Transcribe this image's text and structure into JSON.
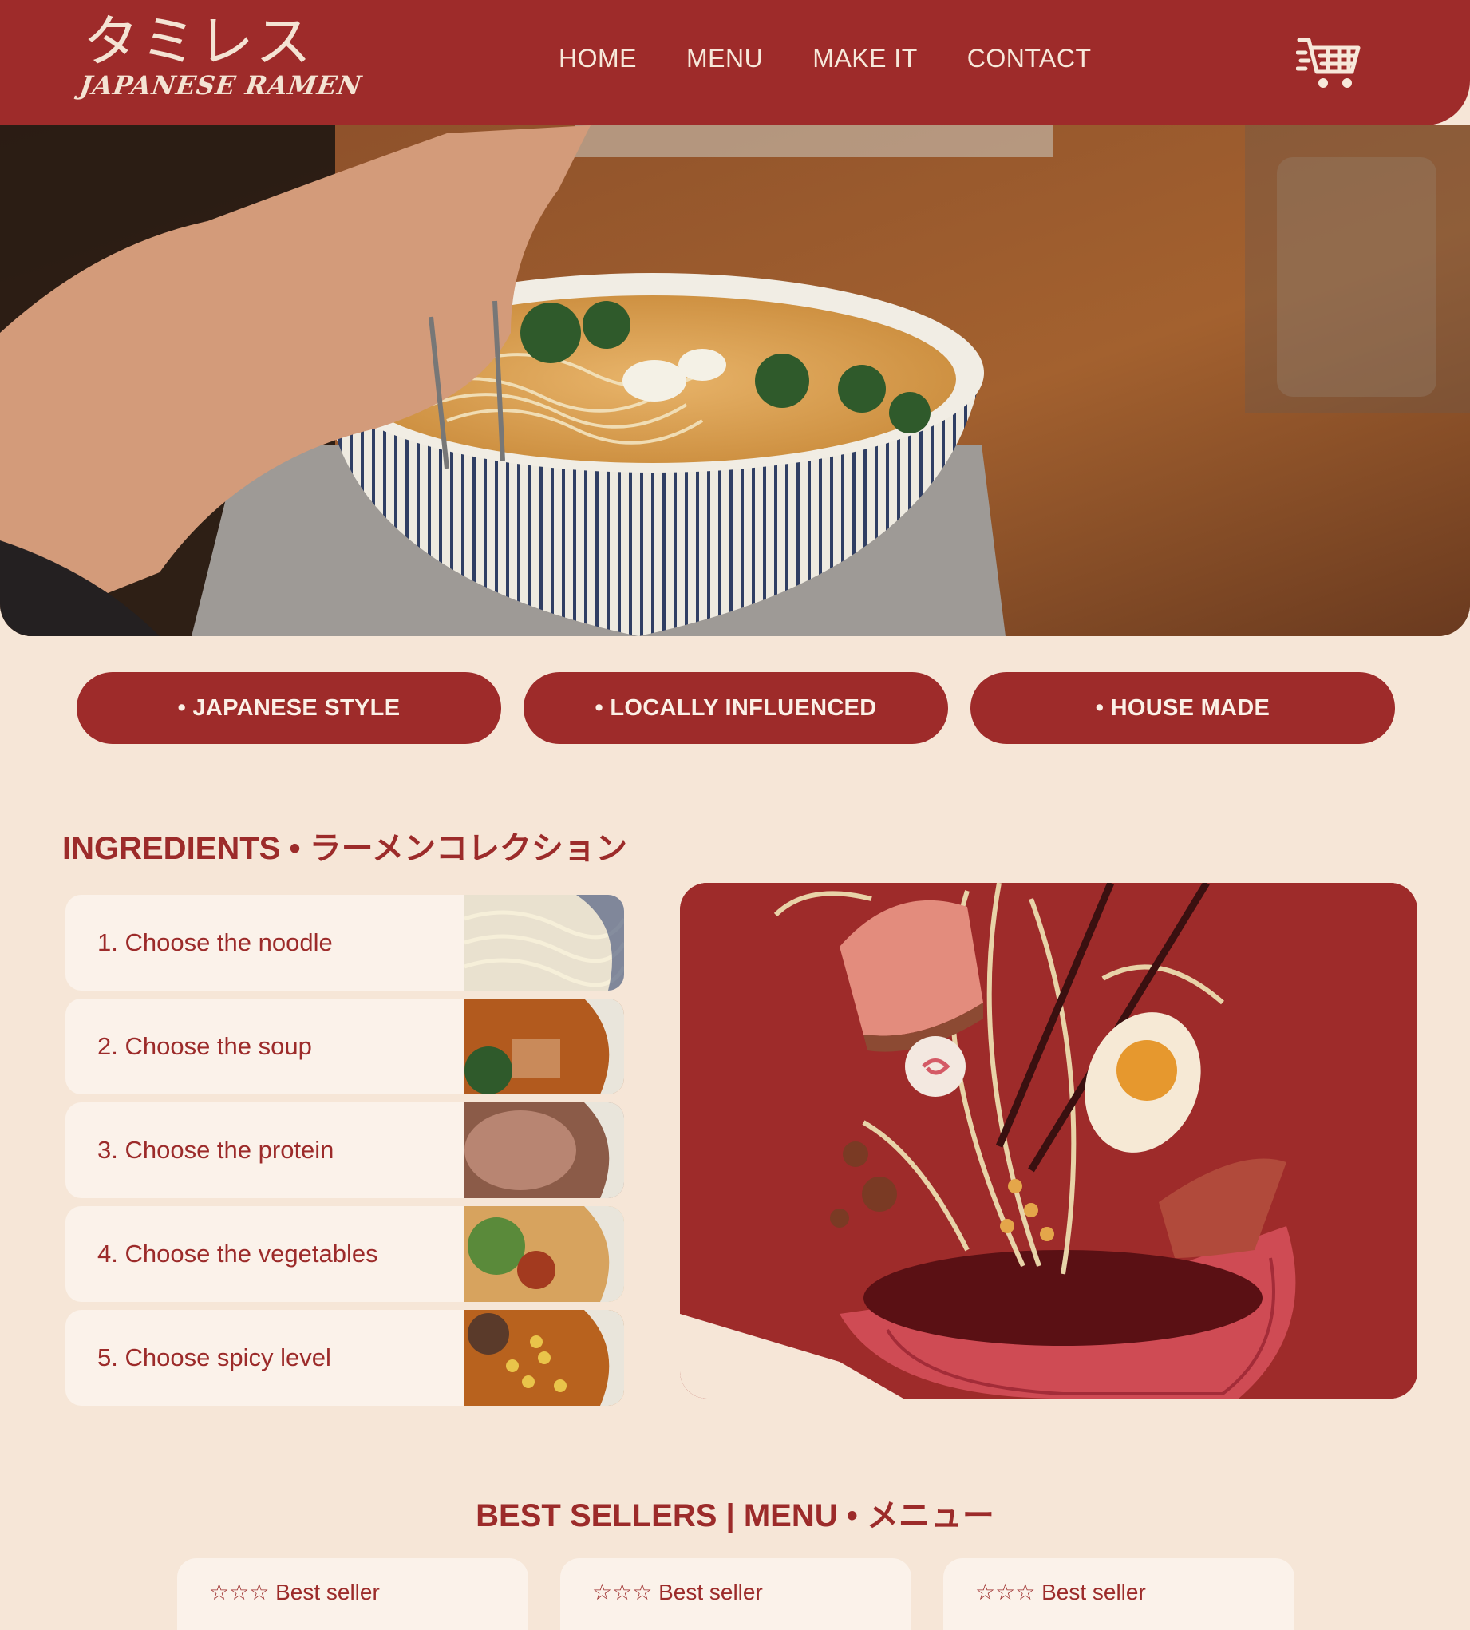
{
  "brand": {
    "name_jp": "タミレス",
    "name_en": "JAPANESE RAMEN"
  },
  "nav": {
    "items": [
      "HOME",
      "MENU",
      "MAKE IT",
      "CONTACT"
    ]
  },
  "pills": [
    {
      "label": "• JAPANESE STYLE"
    },
    {
      "label": "• LOCALLY INFLUENCED"
    },
    {
      "label": "• HOUSE MADE"
    }
  ],
  "ingredients": {
    "title": "INGREDIENTS • ラーメンコレクション",
    "steps": [
      {
        "label": "1. Choose the noodle"
      },
      {
        "label": "2. Choose the soup"
      },
      {
        "label": "3. Choose the protein"
      },
      {
        "label": "4. Choose the vegetables"
      },
      {
        "label": "5. Choose spicy level"
      }
    ]
  },
  "best_sellers": {
    "title": "BEST SELLERS | MENU • メニュー",
    "cards": [
      {
        "label": "☆☆☆ Best seller"
      },
      {
        "label": "☆☆☆ Best seller"
      },
      {
        "label": "☆☆☆ Best seller"
      }
    ]
  },
  "colors": {
    "primary": "#9e2b2a",
    "background": "#f6e6d7",
    "card": "#fbf2ea",
    "text_light": "#f7e8da"
  }
}
